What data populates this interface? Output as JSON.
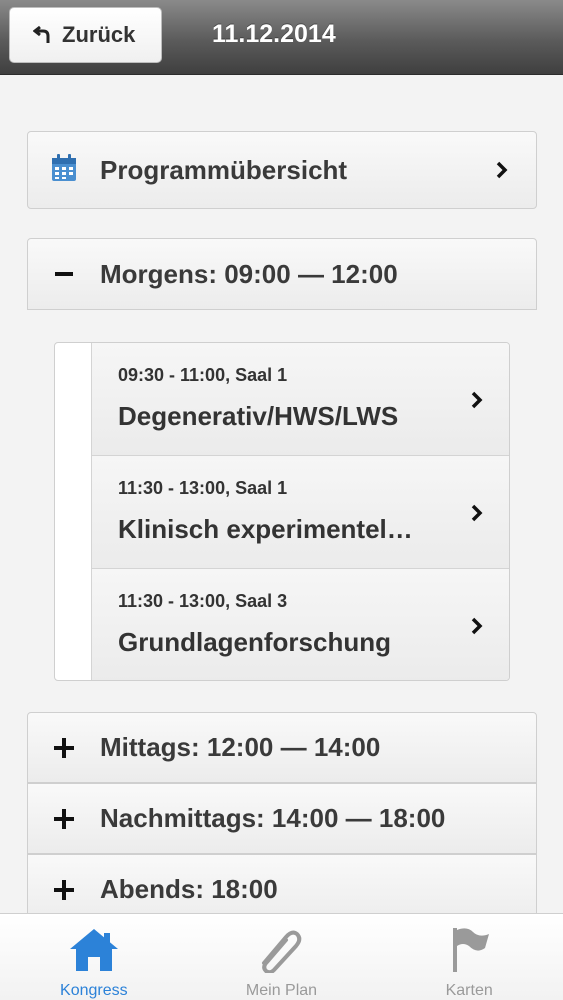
{
  "header": {
    "back_label": "Zurück",
    "title": "11.12.2014"
  },
  "overview": {
    "label": "Programmübersicht",
    "icon": "calendar-icon"
  },
  "morning": {
    "label": "Morgens: 09:00 — 12:00",
    "state": "expanded",
    "sessions": [
      {
        "meta": "09:30 - 11:00, Saal 1",
        "title": "Degenerativ/HWS/LWS"
      },
      {
        "meta": "11:30 - 13:00, Saal 1",
        "title": "Klinisch experimentel…"
      },
      {
        "meta": "11:30 - 13:00, Saal 3",
        "title": "Grundlagenforschung"
      }
    ]
  },
  "sections": [
    {
      "label": "Mittags: 12:00 — 14:00",
      "state": "collapsed"
    },
    {
      "label": "Nachmittags: 14:00 — 18:00",
      "state": "collapsed"
    },
    {
      "label": "Abends: 18:00",
      "state": "collapsed"
    }
  ],
  "tabs": [
    {
      "label": "Kongress",
      "icon": "home-icon",
      "active": true
    },
    {
      "label": "Mein Plan",
      "icon": "paperclip-icon",
      "active": false
    },
    {
      "label": "Karten",
      "icon": "flag-icon",
      "active": false
    }
  ],
  "colors": {
    "accent": "#2c82d8",
    "header_dark": "#3f3f3f",
    "inactive_tab": "#9a9a9a"
  }
}
